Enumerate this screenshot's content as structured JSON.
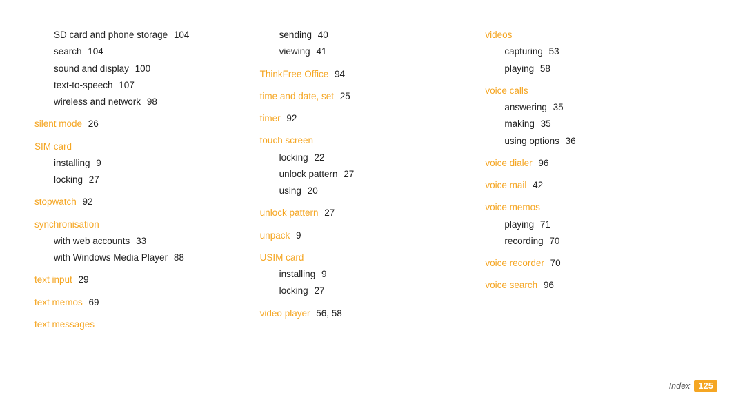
{
  "columns": [
    {
      "id": "col1",
      "entries": [
        {
          "type": "sub",
          "text": "SD card and phone storage",
          "page": "104"
        },
        {
          "type": "sub",
          "text": "search",
          "page": "104"
        },
        {
          "type": "sub",
          "text": "sound and display",
          "page": "100"
        },
        {
          "type": "sub",
          "text": "text-to-speech",
          "page": "107"
        },
        {
          "type": "sub",
          "text": "wireless and network",
          "page": "98"
        },
        {
          "type": "spacer"
        },
        {
          "type": "heading",
          "text": "silent mode",
          "page": "26"
        },
        {
          "type": "spacer"
        },
        {
          "type": "heading",
          "text": "SIM card"
        },
        {
          "type": "sub2",
          "text": "installing",
          "page": "9"
        },
        {
          "type": "sub2",
          "text": "locking",
          "page": "27"
        },
        {
          "type": "spacer"
        },
        {
          "type": "heading",
          "text": "stopwatch",
          "page": "92"
        },
        {
          "type": "spacer"
        },
        {
          "type": "heading",
          "text": "synchronisation"
        },
        {
          "type": "sub2",
          "text": "with web accounts",
          "page": "33"
        },
        {
          "type": "sub2",
          "text": "with Windows Media Player",
          "page": "88"
        },
        {
          "type": "spacer"
        },
        {
          "type": "heading",
          "text": "text input",
          "page": "29"
        },
        {
          "type": "spacer"
        },
        {
          "type": "heading",
          "text": "text memos",
          "page": "69"
        },
        {
          "type": "spacer"
        },
        {
          "type": "heading",
          "text": "text messages"
        }
      ]
    },
    {
      "id": "col2",
      "entries": [
        {
          "type": "sub2",
          "text": "sending",
          "page": "40"
        },
        {
          "type": "sub2",
          "text": "viewing",
          "page": "41"
        },
        {
          "type": "spacer"
        },
        {
          "type": "heading",
          "text": "ThinkFree Office",
          "page": "94"
        },
        {
          "type": "spacer"
        },
        {
          "type": "heading",
          "text": "time and date, set",
          "page": "25"
        },
        {
          "type": "spacer"
        },
        {
          "type": "heading",
          "text": "timer",
          "page": "92"
        },
        {
          "type": "spacer"
        },
        {
          "type": "heading",
          "text": "touch screen"
        },
        {
          "type": "sub2",
          "text": "locking",
          "page": "22"
        },
        {
          "type": "sub2",
          "text": "unlock pattern",
          "page": "27"
        },
        {
          "type": "sub2",
          "text": "using",
          "page": "20"
        },
        {
          "type": "spacer"
        },
        {
          "type": "heading",
          "text": "unlock pattern",
          "page": "27"
        },
        {
          "type": "spacer"
        },
        {
          "type": "heading",
          "text": "unpack",
          "page": "9"
        },
        {
          "type": "spacer"
        },
        {
          "type": "heading",
          "text": "USIM card"
        },
        {
          "type": "sub2",
          "text": "installing",
          "page": "9"
        },
        {
          "type": "sub2",
          "text": "locking",
          "page": "27"
        },
        {
          "type": "spacer"
        },
        {
          "type": "heading",
          "text": "video player",
          "page": "56, 58"
        }
      ]
    },
    {
      "id": "col3",
      "entries": [
        {
          "type": "heading",
          "text": "videos"
        },
        {
          "type": "sub2",
          "text": "capturing",
          "page": "53"
        },
        {
          "type": "sub2",
          "text": "playing",
          "page": "58"
        },
        {
          "type": "spacer"
        },
        {
          "type": "heading",
          "text": "voice calls"
        },
        {
          "type": "sub2",
          "text": "answering",
          "page": "35"
        },
        {
          "type": "sub2",
          "text": "making",
          "page": "35"
        },
        {
          "type": "sub2",
          "text": "using options",
          "page": "36"
        },
        {
          "type": "spacer"
        },
        {
          "type": "heading",
          "text": "voice dialer",
          "page": "96"
        },
        {
          "type": "spacer"
        },
        {
          "type": "heading",
          "text": "voice mail",
          "page": "42"
        },
        {
          "type": "spacer"
        },
        {
          "type": "heading",
          "text": "voice memos"
        },
        {
          "type": "sub2",
          "text": "playing",
          "page": "71"
        },
        {
          "type": "sub2",
          "text": "recording",
          "page": "70"
        },
        {
          "type": "spacer"
        },
        {
          "type": "heading",
          "text": "voice recorder",
          "page": "70"
        },
        {
          "type": "spacer"
        },
        {
          "type": "heading",
          "text": "voice search",
          "page": "96"
        }
      ]
    }
  ],
  "footer": {
    "label": "Index",
    "page": "125"
  }
}
